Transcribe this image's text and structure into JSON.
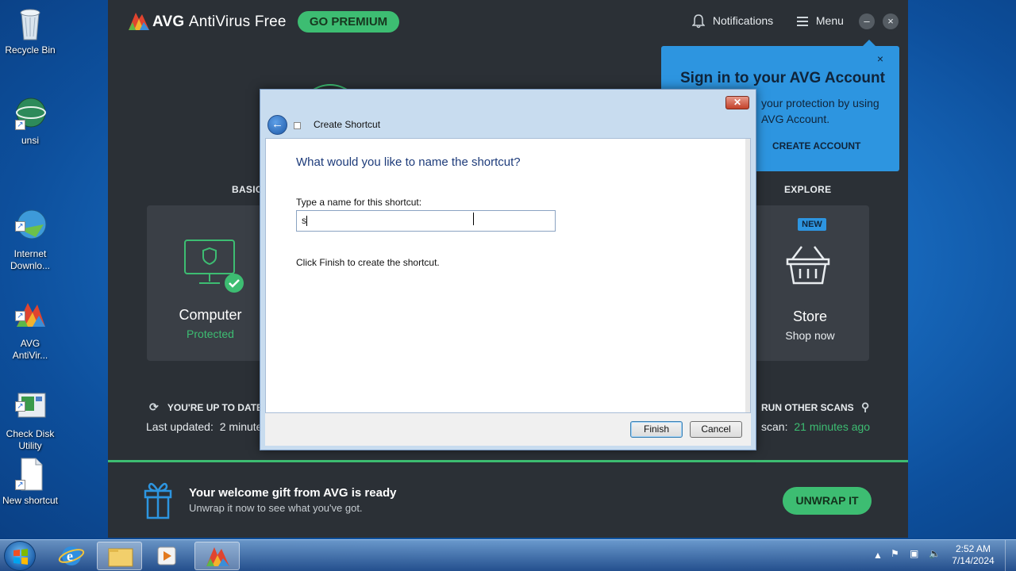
{
  "desktop": {
    "icons": [
      {
        "label": "Recycle Bin"
      },
      {
        "label": "unsi"
      },
      {
        "label": "Internet\nDownlo..."
      },
      {
        "label": "AVG\nAntiVir..."
      },
      {
        "label": "Check Disk\nUtility"
      },
      {
        "label": "New shortcut"
      }
    ]
  },
  "avg": {
    "brand": "AVG",
    "product": "AntiVirus Free",
    "go_premium": "GO PREMIUM",
    "notifications": "Notifications",
    "menu": "Menu",
    "minimize": "–",
    "close": "×",
    "section_basic": "BASIC",
    "section_explore": "EXPLORE",
    "computer_title": "Computer",
    "computer_status": "Protected",
    "store_badge": "NEW",
    "store_title": "Store",
    "store_sub": "Shop now",
    "uptodate": "YOU'RE UP TO DATE",
    "last_updated_label": "Last updated:",
    "last_updated_value": "2 minute",
    "run_other_scans": "RUN OTHER SCANS",
    "scan_label": "scan:",
    "scan_value": "21 minutes ago",
    "signin": {
      "title": "Sign in to your AVG Account",
      "text": "your protection by using AVG Account.",
      "button": "CREATE ACCOUNT",
      "close": "×"
    },
    "gift": {
      "title": "Your welcome gift from AVG is ready",
      "sub": "Unwrap it now to see what you've got.",
      "button": "UNWRAP IT"
    },
    "colors": {
      "accent": "#3dbd72",
      "background": "#2b3036",
      "card": "#3a3f46",
      "signin": "#2d95e0"
    }
  },
  "dialog": {
    "caption": "Create Shortcut",
    "close": "✕",
    "question": "What would you like to name the shortcut?",
    "label": "Type a name for this shortcut:",
    "input_value": "s",
    "hint": "Click Finish to create the shortcut.",
    "finish": "Finish",
    "cancel": "Cancel"
  },
  "taskbar": {
    "time": "2:52 AM",
    "date": "7/14/2024"
  }
}
